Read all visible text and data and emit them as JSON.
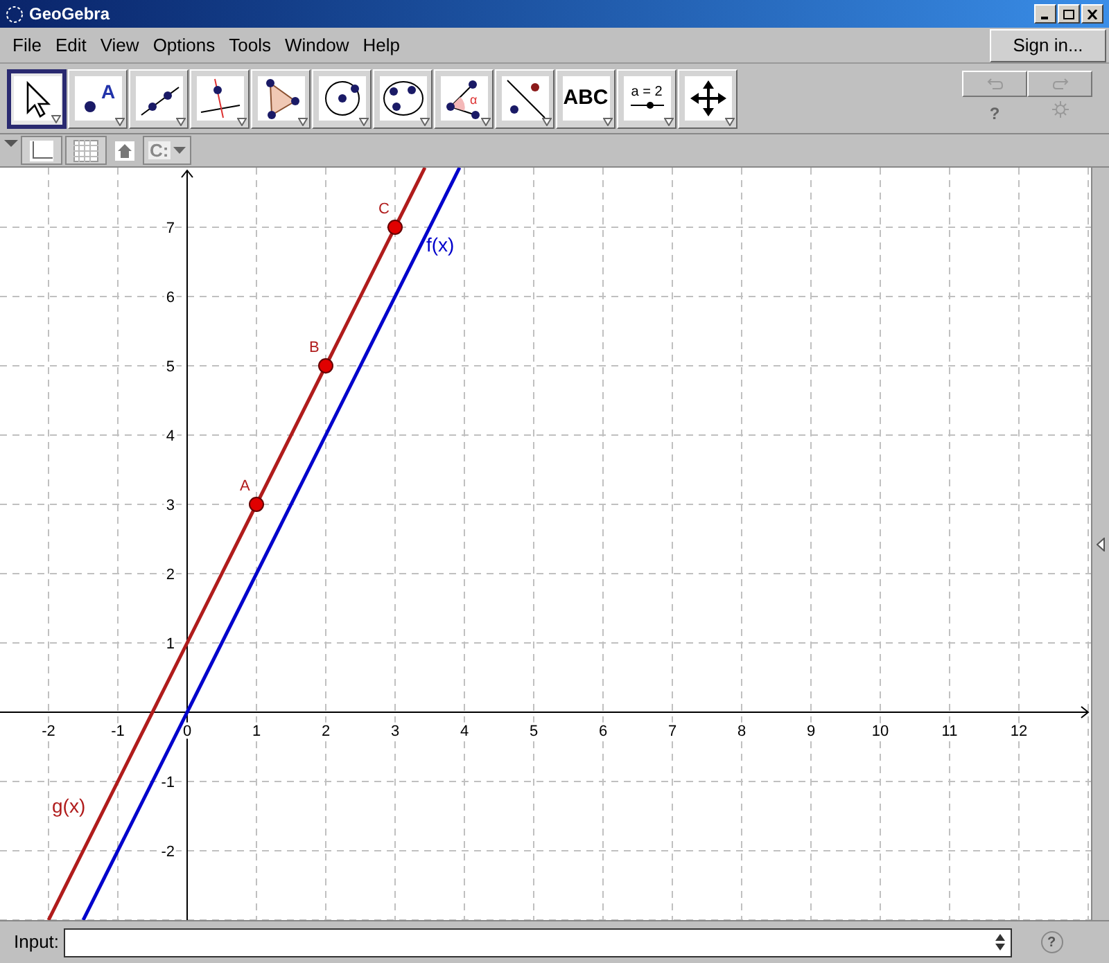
{
  "window": {
    "title": "GeoGebra"
  },
  "menu": [
    "File",
    "Edit",
    "View",
    "Options",
    "Tools",
    "Window",
    "Help"
  ],
  "sign_in": "Sign in...",
  "tools": [
    {
      "kind": "move",
      "selected": true
    },
    {
      "kind": "point",
      "selected": false,
      "label": "A"
    },
    {
      "kind": "line",
      "selected": false
    },
    {
      "kind": "perpendicular",
      "selected": false
    },
    {
      "kind": "polygon",
      "selected": false
    },
    {
      "kind": "circle",
      "selected": false
    },
    {
      "kind": "conic",
      "selected": false
    },
    {
      "kind": "angle",
      "selected": false,
      "label": "α"
    },
    {
      "kind": "reflect",
      "selected": false
    },
    {
      "kind": "text",
      "selected": false,
      "label": "ABC"
    },
    {
      "kind": "slider",
      "selected": false,
      "label": "a = 2"
    },
    {
      "kind": "pan",
      "selected": false
    }
  ],
  "undo_redo": {
    "disabled": true
  },
  "help": "?",
  "view_bar": {
    "drive_label": "C:"
  },
  "graphics": {
    "chart_data": {
      "type": "line",
      "x": [
        -2,
        -1.5,
        3.43,
        3.93
      ],
      "series": [
        {
          "name": "f(x)",
          "color": "#0000cc",
          "values": [
            null,
            -3,
            6.86,
            7.86
          ]
        },
        {
          "name": "g(x)",
          "color": "#b01c1c",
          "values": [
            -3,
            -2,
            7.86,
            null
          ]
        }
      ],
      "xlim": [
        -2.7,
        13.04
      ],
      "ylim": [
        -3,
        7.86
      ],
      "xticks": [
        -2,
        -1,
        0,
        1,
        2,
        3,
        4,
        5,
        6,
        7,
        8,
        9,
        10,
        11,
        12
      ],
      "yticks": [
        -2,
        -1,
        1,
        2,
        3,
        4,
        5,
        6,
        7
      ],
      "grid": true,
      "annotations": [
        {
          "text": "A",
          "x": 1,
          "y": 3
        },
        {
          "text": "B",
          "x": 2,
          "y": 5
        },
        {
          "text": "C",
          "x": 3,
          "y": 7
        }
      ]
    }
  },
  "input_bar": {
    "label": "Input:",
    "help": "?"
  }
}
